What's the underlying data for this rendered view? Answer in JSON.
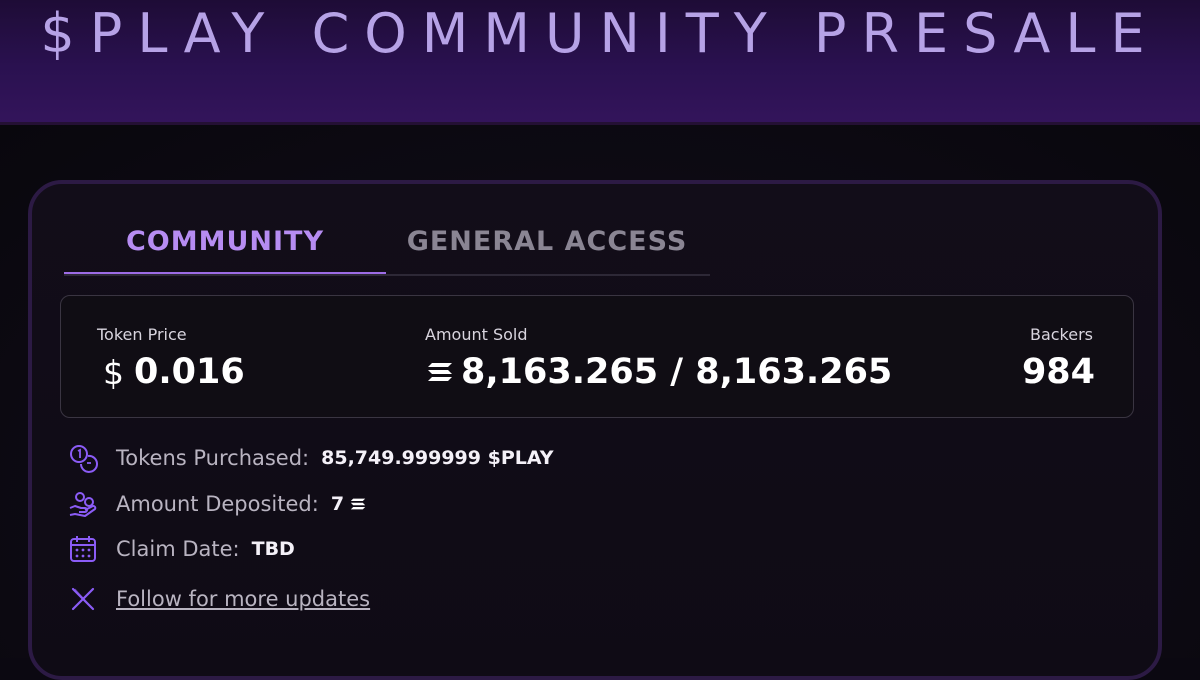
{
  "header": {
    "title": "$PLAY COMMUNITY PRESALE"
  },
  "tabs": [
    {
      "label": "COMMUNITY",
      "active": true
    },
    {
      "label": "GENERAL ACCESS",
      "active": false
    }
  ],
  "stats": {
    "token_price": {
      "label": "Token Price",
      "symbol": "$",
      "value": "0.016"
    },
    "amount_sold": {
      "label": "Amount Sold",
      "value": "8,163.265 / 8,163.265",
      "icon": "solana-icon"
    },
    "backers": {
      "label": "Backers",
      "value": "984"
    }
  },
  "details": {
    "tokens_purchased": {
      "label": "Tokens Purchased:",
      "value": "85,749.999999 $PLAY",
      "icon": "coins-icon"
    },
    "amount_deposited": {
      "label": "Amount Deposited:",
      "value": "7",
      "icon": "hand-coins-icon"
    },
    "claim_date": {
      "label": "Claim Date:",
      "value": "TBD",
      "icon": "calendar-icon"
    },
    "follow": {
      "label": "Follow for more updates",
      "icon": "x-logo-icon"
    }
  },
  "colors": {
    "accent": "#b68cf2",
    "header_text": "#b6a2e6",
    "icon": "#8b5cf6"
  }
}
